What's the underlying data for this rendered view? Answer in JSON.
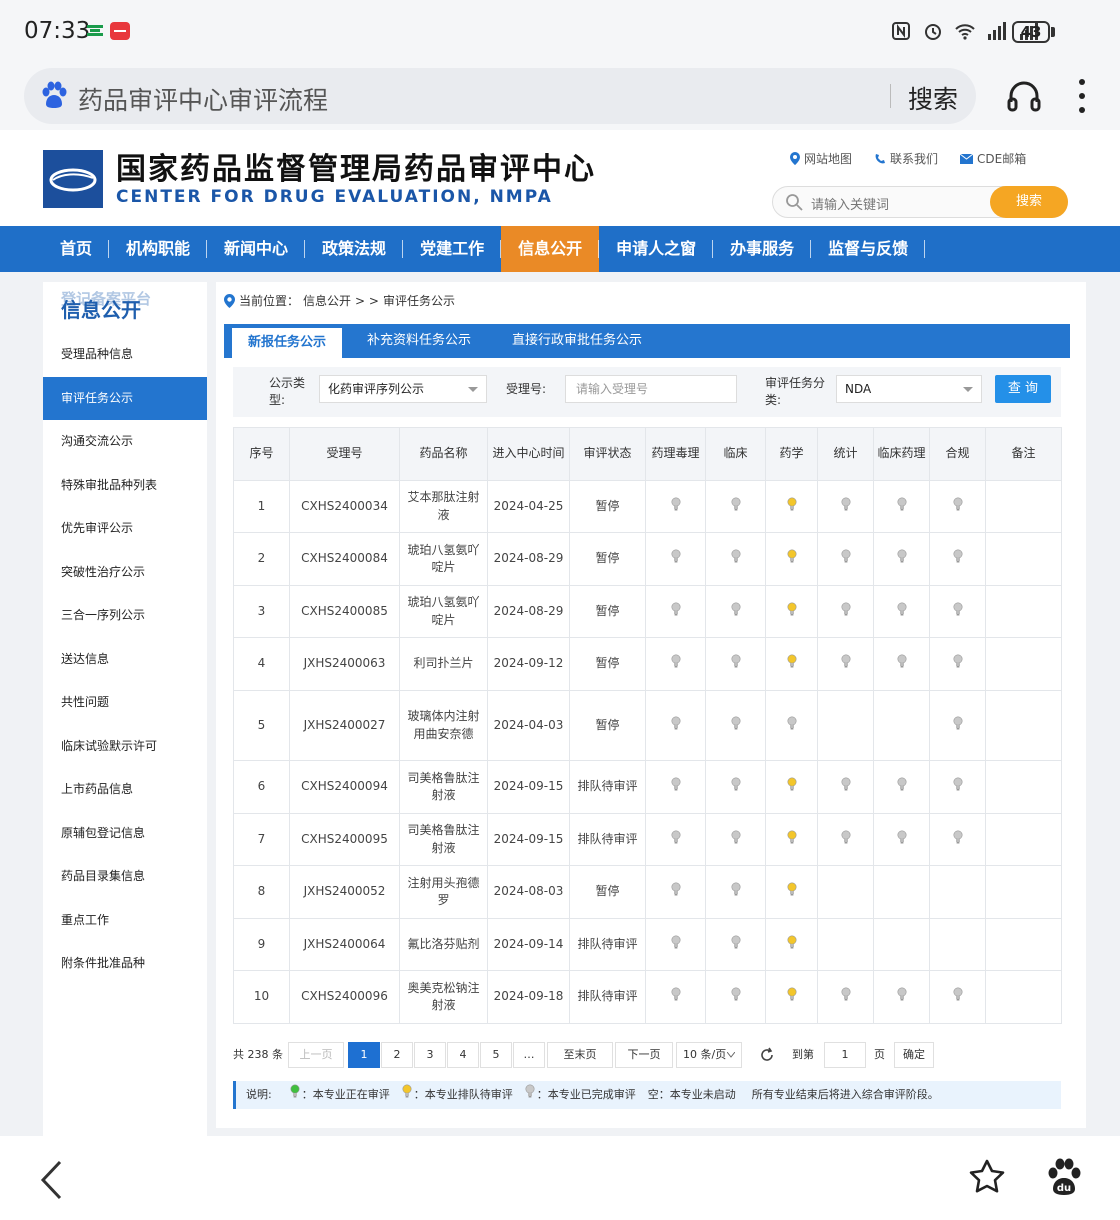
{
  "status_bar": {
    "time": "07:33",
    "battery": "43"
  },
  "browser": {
    "query": "药品审评中心审评流程",
    "search_label": "搜索"
  },
  "site": {
    "title": "国家药品监督管理局药品审评中心",
    "subtitle": "CENTER FOR DRUG EVALUATION, NMPA",
    "links": [
      "网站地图",
      "联系我们",
      "CDE邮箱"
    ],
    "search_placeholder": "请输入关键词",
    "search_button": "搜索"
  },
  "nav": [
    "首页",
    "机构职能",
    "新闻中心",
    "政策法规",
    "党建工作",
    "信息公开",
    "申请人之窗",
    "办事服务",
    "监督与反馈"
  ],
  "nav_active": "信息公开",
  "sidebar": {
    "ghost_text": "登记备案平台",
    "title": "信息公开",
    "items": [
      "受理品种信息",
      "审评任务公示",
      "沟通交流公示",
      "特殊审批品种列表",
      "优先审评公示",
      "突破性治疗公示",
      "三合一序列公示",
      "送达信息",
      "共性问题",
      "临床试验默示许可",
      "上市药品信息",
      "原辅包登记信息",
      "药品目录集信息",
      "重点工作",
      "附条件批准品种"
    ],
    "active": "审评任务公示"
  },
  "breadcrumb": {
    "prefix": "当前位置：",
    "section": "信息公开",
    "sep": "> >",
    "page": "审评任务公示"
  },
  "tabs": [
    "新报任务公示",
    "补充资料任务公示",
    "直接行政审批任务公示"
  ],
  "filters": {
    "type_label": "公示类型:",
    "type_value": "化药审评序列公示",
    "accept_label": "受理号:",
    "accept_placeholder": "请输入受理号",
    "category_label": "审评任务分类:",
    "category_value": "NDA",
    "query_button": "查 询"
  },
  "table": {
    "headers": [
      "序号",
      "受理号",
      "药品名称",
      "进入中心时间",
      "审评状态",
      "药理毒理",
      "临床",
      "药学",
      "统计",
      "临床药理",
      "合规",
      "备注"
    ],
    "rows": [
      {
        "no": "1",
        "accept_no": "CXHS2400034",
        "drug": "艾本那肽注射液",
        "date": "2024-04-25",
        "status": "暂停",
        "pharmtox": "done",
        "clinical": "done",
        "chem": "queue",
        "stats": "done",
        "clinpharm": "done",
        "compliance": "done"
      },
      {
        "no": "2",
        "accept_no": "CXHS2400084",
        "drug": "琥珀八氢氨吖啶片",
        "date": "2024-08-29",
        "status": "暂停",
        "pharmtox": "done",
        "clinical": "done",
        "chem": "queue",
        "stats": "done",
        "clinpharm": "done",
        "compliance": "done"
      },
      {
        "no": "3",
        "accept_no": "CXHS2400085",
        "drug": "琥珀八氢氨吖啶片",
        "date": "2024-08-29",
        "status": "暂停",
        "pharmtox": "done",
        "clinical": "done",
        "chem": "queue",
        "stats": "done",
        "clinpharm": "done",
        "compliance": "done"
      },
      {
        "no": "4",
        "accept_no": "JXHS2400063",
        "drug": "利司扑兰片",
        "date": "2024-09-12",
        "status": "暂停",
        "pharmtox": "done",
        "clinical": "done",
        "chem": "queue",
        "stats": "done",
        "clinpharm": "done",
        "compliance": "done"
      },
      {
        "no": "5",
        "accept_no": "JXHS2400027",
        "drug": "玻璃体内注射用曲安奈德",
        "date": "2024-04-03",
        "status": "暂停",
        "pharmtox": "done",
        "clinical": "done",
        "chem": "done",
        "stats": "",
        "clinpharm": "",
        "compliance": "done"
      },
      {
        "no": "6",
        "accept_no": "CXHS2400094",
        "drug": "司美格鲁肽注射液",
        "date": "2024-09-15",
        "status": "排队待审评",
        "pharmtox": "done",
        "clinical": "done",
        "chem": "queue",
        "stats": "done",
        "clinpharm": "done",
        "compliance": "done"
      },
      {
        "no": "7",
        "accept_no": "CXHS2400095",
        "drug": "司美格鲁肽注射液",
        "date": "2024-09-15",
        "status": "排队待审评",
        "pharmtox": "done",
        "clinical": "done",
        "chem": "queue",
        "stats": "done",
        "clinpharm": "done",
        "compliance": "done"
      },
      {
        "no": "8",
        "accept_no": "JXHS2400052",
        "drug": "注射用头孢德罗",
        "date": "2024-08-03",
        "status": "暂停",
        "pharmtox": "done",
        "clinical": "done",
        "chem": "queue",
        "stats": "",
        "clinpharm": "",
        "compliance": ""
      },
      {
        "no": "9",
        "accept_no": "JXHS2400064",
        "drug": "氟比洛芬贴剂",
        "date": "2024-09-14",
        "status": "排队待审评",
        "pharmtox": "done",
        "clinical": "done",
        "chem": "queue",
        "stats": "",
        "clinpharm": "",
        "compliance": ""
      },
      {
        "no": "10",
        "accept_no": "CXHS2400096",
        "drug": "奥美克松钠注射液",
        "date": "2024-09-18",
        "status": "排队待审评",
        "pharmtox": "done",
        "clinical": "done",
        "chem": "queue",
        "stats": "done",
        "clinpharm": "done",
        "compliance": "done"
      }
    ]
  },
  "pager": {
    "total": "共 238 条",
    "prev": "上一页",
    "pages": [
      "1",
      "2",
      "3",
      "4",
      "5",
      "…"
    ],
    "current": "1",
    "last": "至末页",
    "next": "下一页",
    "per_page": "10 条/页",
    "goto_label": "到第",
    "goto_value": "1",
    "page_unit": "页",
    "confirm": "确定"
  },
  "legend": {
    "title": "说明:",
    "active": "：本专业正在审评",
    "queue": "：本专业排队待审评",
    "done": "：本专业已完成审评",
    "empty": "空：本专业未启动",
    "note": "所有专业结束后将进入综合审评阶段。"
  },
  "colors": {
    "nav_blue": "#1f6fc8",
    "nav_active": "#ea8a26",
    "queue_bulb": "#f3c62b",
    "active_bulb": "#3fbf3f",
    "done_bulb": "#c8c8c8"
  }
}
